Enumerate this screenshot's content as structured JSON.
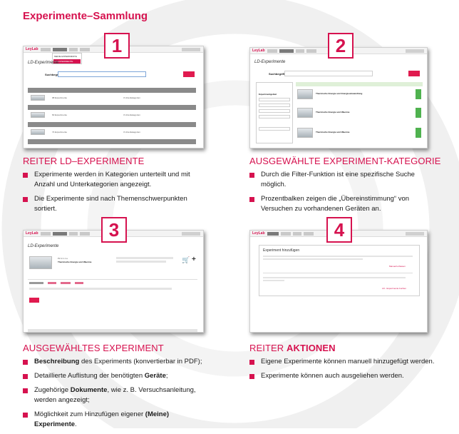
{
  "page": {
    "title": "Experimente–Sammlung"
  },
  "badges": [
    "1",
    "2",
    "3",
    "4"
  ],
  "sections": [
    {
      "title_pre": "REITER LD–EXPERIMENTE",
      "title_bold": "",
      "bullets": [
        "Experimente werden in Kategorien unterteilt und mit Anzahl und Unterkategorien angezeigt.",
        "Die Experimente sind nach Themenschwerpunkten sortiert."
      ]
    },
    {
      "title_pre": "AUSGEWÄHLTE EXPERIMENT-KATEGORIE",
      "title_bold": "",
      "bullets": [
        "Durch die Filter-Funktion ist eine spezifische Suche möglich.",
        "Prozentbalken zeigen die „Übereinstimmung“ von Versuchen zu vorhandenen Geräten an."
      ]
    },
    {
      "title_pre": "AUSGEWÄHLTES EXPERIMENT",
      "title_bold": "",
      "bullets": [
        {
          "bold": "Beschreibung",
          "rest": " des Experiments (konvertierbar in PDF);"
        },
        {
          "pre": "Detaillierte Auflistung der benötigten ",
          "bold": "Geräte",
          "rest": ";"
        },
        {
          "pre": "Zugehörige ",
          "bold": "Dokumente",
          "rest": ", wie z. B. Versuchsanleitung, werden angezeigt;"
        },
        {
          "pre": "Möglichkeit zum Hinzufügen eigener ",
          "bold": "(Meine) Experimente",
          "rest": "."
        }
      ]
    },
    {
      "title_pre": "REITER ",
      "title_bold": "AKTIONEN",
      "bullets": [
        "Eigene Experimente können manuell hinzugefügt werden.",
        "Experimente können auch ausgeliehen werden."
      ]
    }
  ],
  "screens": {
    "s1": {
      "logo": "LeyLab",
      "heading": "LD-Experimente",
      "search_label": "Suchbegriff",
      "search_button": "Suchen",
      "dropdown": [
        "MEINE EXPERIMENTE",
        "LD-EXPERIMENTE"
      ],
      "rows": [
        {
          "left": "98 Experimente",
          "right": "3 Unterkategorien"
        },
        {
          "left": "60 Experimente",
          "right": "3 Unterkategorien"
        },
        {
          "left": "74 Experimente",
          "right": "3 Unterkategorien"
        }
      ]
    },
    "s2": {
      "logo": "LeyLab",
      "heading": "LD-Experimente",
      "search_label": "Suchbegriff",
      "search_button": "Suchen",
      "filter_label": "Experimentgebiet",
      "results": [
        "Thermische Energie und Energieumwandlung",
        "Thermische Energie und Waerme",
        "Thermische Energie und Waerme"
      ]
    },
    "s3": {
      "logo": "LeyLab",
      "heading": "LD-Experimente",
      "code": "P2.1.1.1 a",
      "name": "Thermische Energie und Waerme",
      "action_button": "Ablauf"
    },
    "s4": {
      "logo": "LeyLab",
      "panel_title": "Experiment hinzufügen",
      "link1": "Manuell erfassen",
      "link2": "LD - Experimente buchen"
    }
  },
  "colors": {
    "accent": "#d6124f",
    "green": "#4fb24f"
  }
}
